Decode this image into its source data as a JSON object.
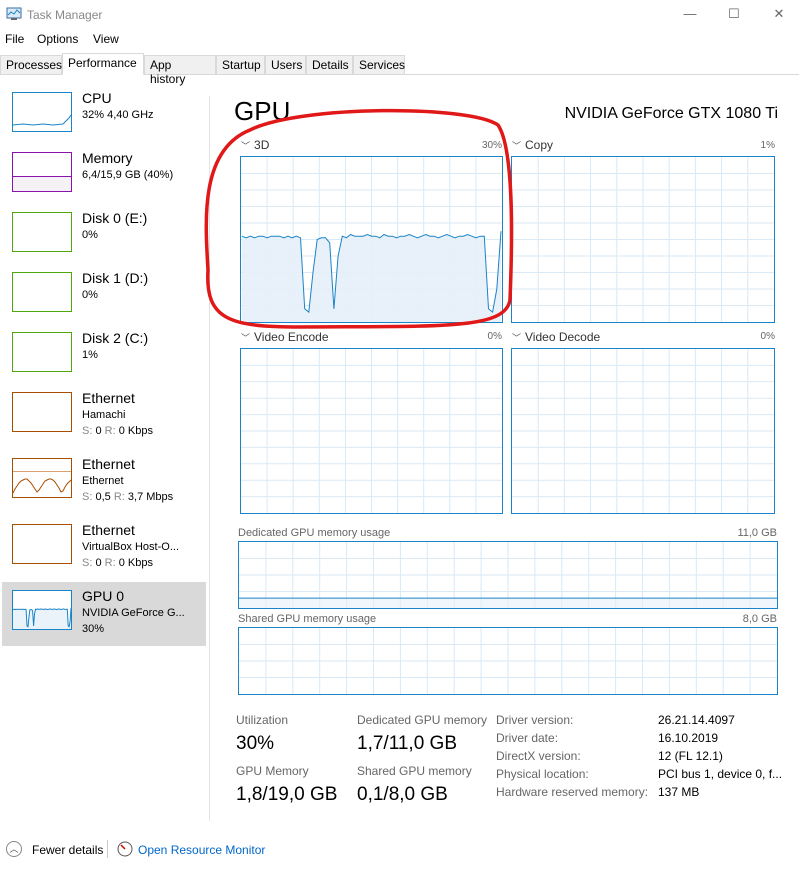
{
  "window": {
    "title": "Task Manager",
    "minimize": "—",
    "maximize": "☐",
    "close": "✕"
  },
  "menu": [
    "File",
    "Options",
    "View"
  ],
  "tabs": [
    "Processes",
    "Performance",
    "App history",
    "Startup",
    "Users",
    "Details",
    "Services"
  ],
  "active_tab": "Performance",
  "sidebar": [
    {
      "name": "CPU",
      "sub1": "32% 4,40 GHz",
      "color": "#1a84c7"
    },
    {
      "name": "Memory",
      "sub1": "6,4/15,9 GB (40%)",
      "color": "#8b12ae"
    },
    {
      "name": "Disk 0 (E:)",
      "sub1": "0%",
      "color": "#4da60c"
    },
    {
      "name": "Disk 1 (D:)",
      "sub1": "0%",
      "color": "#4da60c"
    },
    {
      "name": "Disk 2 (C:)",
      "sub1": "1%",
      "color": "#4da60c"
    },
    {
      "name": "Ethernet",
      "sub1": "Hamachi",
      "s_label": "S:",
      "s": "0",
      "r_label": "R:",
      "r": "0 Kbps",
      "color": "#a74f01"
    },
    {
      "name": "Ethernet",
      "sub1": "Ethernet",
      "s_label": "S:",
      "s": "0,5",
      "r_label": "R:",
      "r": "3,7 Mbps",
      "color": "#a74f01"
    },
    {
      "name": "Ethernet",
      "sub1": "VirtualBox Host-O...",
      "s_label": "S:",
      "s": "0",
      "r_label": "R:",
      "r": "0 Kbps",
      "color": "#a74f01"
    },
    {
      "name": "GPU 0",
      "sub1": "NVIDIA GeForce G...",
      "sub2": "30%",
      "color": "#1a84c7"
    }
  ],
  "main": {
    "title": "GPU",
    "model": "NVIDIA GeForce GTX 1080 Ti",
    "engines": [
      {
        "label": "3D",
        "pct": "30%"
      },
      {
        "label": "Copy",
        "pct": "1%"
      },
      {
        "label": "Video Encode",
        "pct": "0%"
      },
      {
        "label": "Video Decode",
        "pct": "0%"
      }
    ],
    "dedicated": {
      "label": "Dedicated GPU memory usage",
      "max": "11,0 GB"
    },
    "shared": {
      "label": "Shared GPU memory usage",
      "max": "8,0 GB"
    },
    "stats": {
      "utilization_label": "Utilization",
      "utilization": "30%",
      "dedicated_label": "Dedicated GPU memory",
      "dedicated": "1,7/11,0 GB",
      "gpu_memory_label": "GPU Memory",
      "gpu_memory": "1,8/19,0 GB",
      "shared_label": "Shared GPU memory",
      "shared": "0,1/8,0 GB"
    },
    "info": [
      {
        "label": "Driver version:",
        "value": "26.21.14.4097"
      },
      {
        "label": "Driver date:",
        "value": "16.10.2019"
      },
      {
        "label": "DirectX version:",
        "value": "12 (FL 12.1)"
      },
      {
        "label": "Physical location:",
        "value": "PCI bus 1, device 0, f..."
      },
      {
        "label": "Hardware reserved memory:",
        "value": "137 MB"
      }
    ]
  },
  "series_3d": [
    52,
    51,
    52,
    51,
    52,
    52,
    51,
    52,
    52,
    52,
    51,
    52,
    51,
    52,
    51,
    8,
    6,
    30,
    50,
    51,
    51,
    48,
    8,
    40,
    52,
    51,
    53,
    52,
    52,
    52,
    53,
    52,
    52,
    51,
    53,
    52,
    52,
    51,
    52,
    52,
    53,
    52,
    51,
    52,
    53,
    52,
    52,
    51,
    52,
    53,
    52,
    51,
    52,
    52,
    53,
    52,
    51,
    52,
    52,
    8,
    6,
    20,
    55
  ],
  "dedicated_pct": 15,
  "footer": {
    "fewer": "Fewer details",
    "monitor": "Open Resource Monitor"
  }
}
